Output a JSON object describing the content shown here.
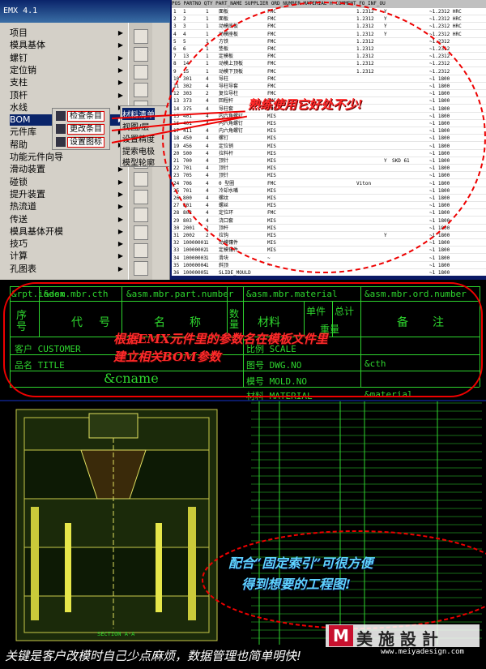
{
  "menu": {
    "title": "EMX 4.1",
    "items": [
      {
        "label": "项目",
        "sub": true
      },
      {
        "label": "模具基体",
        "sub": true
      },
      {
        "label": "螺钉",
        "sub": true
      },
      {
        "label": "定位销",
        "sub": true
      },
      {
        "label": "支柱",
        "sub": true
      },
      {
        "label": "顶杆",
        "sub": true
      },
      {
        "label": "水线",
        "sub": true
      },
      {
        "label": "BOM",
        "sub": true
      },
      {
        "label": "元件库",
        "sub": true
      },
      {
        "label": "帮助",
        "sub": true
      },
      {
        "label": "功能元件向导",
        "sub": false
      },
      {
        "label": "滑动装置",
        "sub": true
      },
      {
        "label": "碰锁",
        "sub": true
      },
      {
        "label": "提升装置",
        "sub": true
      },
      {
        "label": "热流道",
        "sub": true
      },
      {
        "label": "传送",
        "sub": true
      },
      {
        "label": "模具基体开模",
        "sub": true
      },
      {
        "label": "技巧",
        "sub": true
      },
      {
        "label": "计算",
        "sub": true
      },
      {
        "label": "孔图表",
        "sub": true
      }
    ],
    "bom_sub": [
      "检查条目",
      "更改条目",
      "设置图标"
    ],
    "bom_sub2": [
      "材料清单",
      "视图/层",
      "设置精度",
      "提索电极",
      "模型轮廓"
    ]
  },
  "table": {
    "header": "POS  PARTNO  QTY  PART_NAME          SUPPLIER    ORD_NUMBER            MATERIAL   H  COMMENT     FO_INF_OU",
    "rows": [
      [
        "1",
        "1",
        "1",
        "面板",
        "FMC",
        "",
        "1.2312",
        "Y",
        "",
        "~1.2312 HRC"
      ],
      [
        "2",
        "2",
        "1",
        "面板",
        "FMC",
        "",
        "1.2312",
        "Y",
        "",
        "~1.2312 HRC"
      ],
      [
        "3",
        "3",
        "1",
        "动模底板",
        "FMC",
        "",
        "1.2312",
        "Y",
        "",
        "~1.2312 HRC"
      ],
      [
        "4",
        "4",
        "1",
        "动模座板",
        "FMC",
        "",
        "1.2312",
        "Y",
        "",
        "~1.2312 HRC"
      ],
      [
        "5",
        "5",
        "1",
        "方铁",
        "FMC",
        "",
        "1.2312",
        "",
        "",
        "~1.2312"
      ],
      [
        "6",
        "6",
        "1",
        "垫板",
        "FMC",
        "",
        "1.2312",
        "",
        "",
        "~1.2312"
      ],
      [
        "7",
        "13",
        "1",
        "定模板",
        "FMC",
        "",
        "1.2312",
        "",
        "",
        "~1.2312"
      ],
      [
        "8",
        "14",
        "1",
        "动模上顶板",
        "FMC",
        "",
        "1.2312",
        "",
        "",
        "~1.2312"
      ],
      [
        "9",
        "15",
        "1",
        "动模下顶板",
        "FMC",
        "",
        "1.2312",
        "",
        "",
        "~1.2312"
      ],
      [
        "10",
        "301",
        "4",
        "导柱",
        "FMC",
        "",
        "",
        "",
        "",
        "~1 1800"
      ],
      [
        "11",
        "302",
        "4",
        "导柱导套",
        "FMC",
        "",
        "",
        "",
        "",
        "~1 1800"
      ],
      [
        "12",
        "303",
        "2",
        "复位导柱",
        "FMC",
        "",
        "",
        "",
        "",
        "~1 1800"
      ],
      [
        "13",
        "373",
        "4",
        "回程杆",
        "FMC",
        "",
        "",
        "",
        "",
        "~1 1800"
      ],
      [
        "14",
        "375",
        "4",
        "导柱套",
        "FMC",
        "",
        "",
        "",
        "",
        "~1 1800"
      ],
      [
        "15",
        "401",
        "4",
        "内六角螺钉",
        "MIS",
        "",
        "",
        "",
        "",
        "~1 1800"
      ],
      [
        "16",
        "401",
        "4",
        "内六角螺钉",
        "MIS",
        "",
        "",
        "",
        "",
        "~1 1800"
      ],
      [
        "17",
        "411",
        "4",
        "内六角螺钉",
        "MIS",
        "",
        "",
        "",
        "",
        "~1 1800"
      ],
      [
        "18",
        "450",
        "4",
        "螺钉",
        "MIS",
        "",
        "",
        "",
        "",
        "~1 1800"
      ],
      [
        "19",
        "456",
        "4",
        "定位销",
        "MIS",
        "",
        "",
        "",
        "",
        "~1 1800"
      ],
      [
        "20",
        "500",
        "4",
        "拉料杆",
        "MIS",
        "",
        "",
        "",
        "",
        "~1 1800"
      ],
      [
        "21",
        "700",
        "4",
        "顶针",
        "MIS",
        "",
        "",
        "Y",
        "SKD 61",
        "~1 1800"
      ],
      [
        "22",
        "701",
        "4",
        "顶针",
        "MIS",
        "",
        "",
        "",
        "",
        "~1 1800"
      ],
      [
        "23",
        "705",
        "4",
        "顶针",
        "MIS",
        "",
        "",
        "",
        "",
        "~1 1800"
      ],
      [
        "24",
        "706",
        "4",
        "0 型圈",
        "FMC",
        "",
        "Viton",
        "",
        "",
        "~1 1800"
      ],
      [
        "25",
        "701",
        "4",
        "冷却水嘴",
        "MIS",
        "",
        "",
        "",
        "",
        "~1 1800"
      ],
      [
        "26",
        "800",
        "4",
        "螺纹",
        "MIS",
        "",
        "",
        "",
        "",
        "~1 1800"
      ],
      [
        "27",
        "801",
        "4",
        "螺丝",
        "MIS",
        "",
        "",
        "",
        "",
        "~1 1800"
      ],
      [
        "28",
        "802",
        "4",
        "定位环",
        "FMC",
        "",
        "",
        "",
        "",
        "~1 1800"
      ],
      [
        "29",
        "803",
        "4",
        "浇口套",
        "MIS",
        "",
        "",
        "",
        "",
        "~1 1800"
      ],
      [
        "30",
        "2001",
        "2",
        "顶杆",
        "MIS",
        "",
        "",
        "",
        "",
        "~1 1800"
      ],
      [
        "31",
        "2002",
        "2",
        "拉钩",
        "MIS",
        "",
        "",
        "Y",
        "",
        "~1 1800"
      ],
      [
        "32",
        "10000001",
        "1",
        "动模镶件",
        "MIS",
        "",
        "",
        "",
        "",
        "~1 1800"
      ],
      [
        "33",
        "10000002",
        "1",
        "定模镶件",
        "MIS",
        "",
        "",
        "",
        "",
        "~1 1800"
      ],
      [
        "34",
        "10000003",
        "1",
        "滑块",
        "~",
        "",
        "",
        "",
        "",
        "~1 1800"
      ],
      [
        "35",
        "10000004",
        "1",
        "斜顶",
        "~",
        "",
        "",
        "",
        "",
        "~1 1800"
      ],
      [
        "36",
        "10000005",
        "1",
        "SLIDE_MOULD",
        "",
        "",
        "",
        "",
        "",
        "~1 1800"
      ]
    ],
    "note": "熟练使用它好处不少!"
  },
  "bom": {
    "params": [
      "&rpt.index",
      "&asm.mbr.cth",
      "&asm.mbr.part.number",
      "&asm.mbr.material",
      "&asm.mbr.ord.number"
    ],
    "col_headers": [
      "序号",
      "代号",
      "名称",
      "数量",
      "材料",
      "单件",
      "总计",
      "备注"
    ],
    "weight_label": "重量",
    "customer_label": "客户 CUSTOMER",
    "title_label": "品名 TITLE",
    "name_param": "&cname",
    "material_label": "材料 MATERIAL",
    "dwg_label": "图号 DWG.NO",
    "mold_label": "模号 MOLD.NO",
    "scale_label": "比例 SCALE",
    "material_param": "&material",
    "cth_param": "&cth",
    "note_line1": "根据EMX元件里的参数名在模板文件里",
    "note_line2": "建立相关BOM参数"
  },
  "drawing": {
    "note1": "配合“固定索引”可很方便",
    "note2": "得到想要的工程图!",
    "section_label": "SECTION A-A"
  },
  "bottom_note": "关键是客户改模时自己少点麻烦，数据管理也简单明快!",
  "logo": {
    "mark": "M",
    "text": "美 施 設 計",
    "url": "www.meiyadesign.com"
  }
}
